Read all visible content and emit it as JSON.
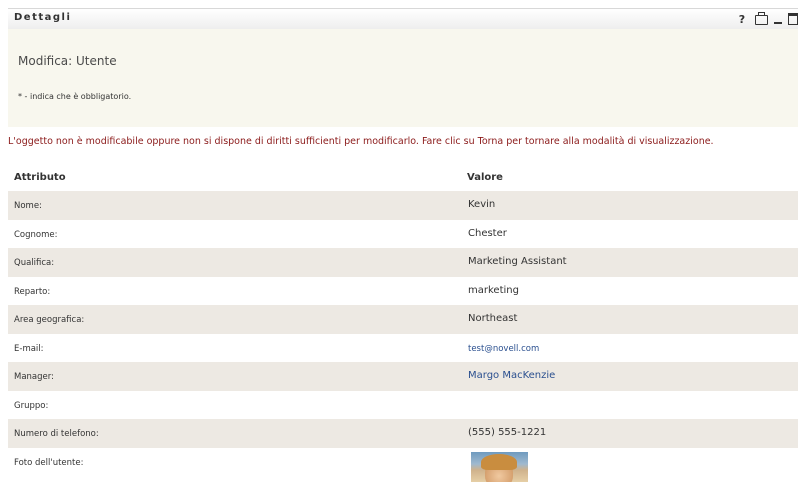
{
  "titlebar": {
    "title": "Dettagli",
    "help_label": "?"
  },
  "header": {
    "form_title": "Modifica: Utente",
    "required_note": "* - indica che è obbligatorio."
  },
  "warning": "L'oggetto non è modificabile oppure non si dispone di diritti sufficienti per modificarlo. Fare clic su Torna per tornare alla modalità di visualizzazione.",
  "table": {
    "col_attr": "Attributo",
    "col_value": "Valore",
    "rows": [
      {
        "attr": "Nome:",
        "value": "Kevin"
      },
      {
        "attr": "Cognome:",
        "value": "Chester"
      },
      {
        "attr": "Qualifica:",
        "value": "Marketing Assistant"
      },
      {
        "attr": "Reparto:",
        "value": "marketing"
      },
      {
        "attr": "Area geografica:",
        "value": "Northeast"
      },
      {
        "attr": "E-mail:",
        "value": "test@novell.com"
      },
      {
        "attr": "Manager:",
        "value": "Margo MacKenzie"
      },
      {
        "attr": "Gruppo:",
        "value": ""
      },
      {
        "attr": "Numero di telefono:",
        "value": "(555) 555-1221"
      },
      {
        "attr": "Foto dell'utente:",
        "value": ""
      }
    ]
  }
}
